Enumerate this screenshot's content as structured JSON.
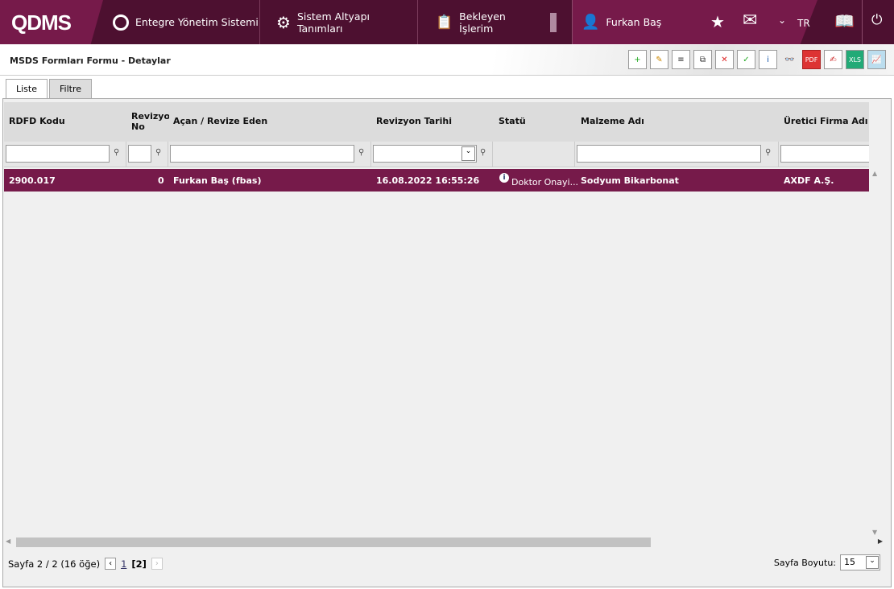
{
  "header": {
    "logo": "QDMS",
    "nav": [
      {
        "label": "Entegre Yönetim Sistemi",
        "icon": "q-icon"
      },
      {
        "label": "Sistem Altyapı Tanımları",
        "icon": "gear-icon"
      },
      {
        "label": "Bekleyen İşlerim",
        "icon": "clipboard-check-icon"
      }
    ],
    "user": "Furkan Baş",
    "language": "TR"
  },
  "page": {
    "title": "MSDS Formları Formu - Detaylar",
    "toolbar": [
      "add-record",
      "edit-record",
      "list",
      "copy",
      "delete-record",
      "approve-record",
      "info-record",
      "binoculars",
      "pdf",
      "sign",
      "export-xls",
      "chart"
    ]
  },
  "tabs": [
    {
      "label": "Liste",
      "active": true
    },
    {
      "label": "Filtre",
      "active": false
    }
  ],
  "grid": {
    "columns": [
      "RDFD Kodu",
      "Revizyon No",
      "Açan / Revize Eden",
      "Revizyon Tarihi",
      "Statü",
      "Malzeme Adı",
      "Üretici Firma Adı"
    ],
    "rows": [
      {
        "code": "2900.017",
        "rev": "0",
        "owner": "Furkan Baş (fbas)",
        "date": "16.08.2022 16:55:26",
        "status": "Doktor Onayi...",
        "material": "Sodyum Bikarbonat",
        "manufacturer": "AXDF A.Ş."
      }
    ]
  },
  "pager": {
    "summary": "Sayfa 2 / 2 (16 öğe)",
    "pages": [
      "1",
      "[2]"
    ],
    "size_label": "Sayfa Boyutu:",
    "size": "15"
  },
  "colors": {
    "brand_dark": "#4d1030",
    "brand": "#761a4a"
  }
}
